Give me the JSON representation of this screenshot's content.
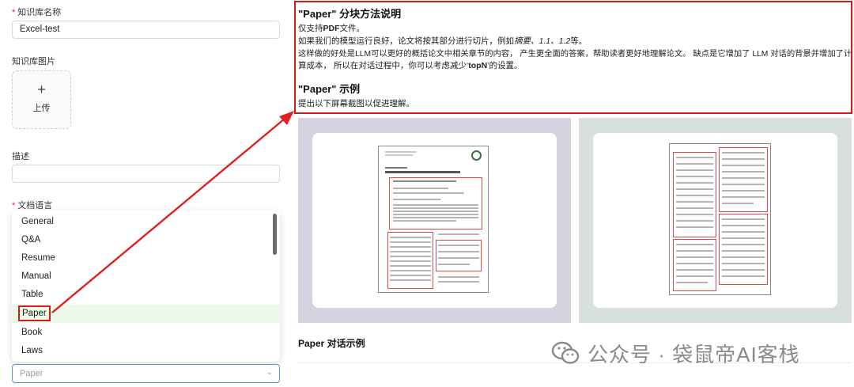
{
  "form": {
    "kb_name_label": "知识库名称",
    "kb_name_value": "Excel-test",
    "kb_image_label": "知识库图片",
    "upload_plus": "+",
    "upload_label": "上传",
    "description_label": "描述",
    "doc_language_label": "文档语言",
    "required_mark": "*",
    "chunk_method_options": [
      "General",
      "Q&A",
      "Resume",
      "Manual",
      "Table",
      "Paper",
      "Book",
      "Laws"
    ],
    "selected_option": "Paper",
    "select_placeholder": "Paper",
    "chevron": "⌄"
  },
  "doc": {
    "heading1": "\"Paper\" 分块方法说明",
    "line1_pre": "仅支持",
    "line1_bold": "PDF",
    "line1_post": "文件。",
    "line2_pre": "如果我们的模型运行良好，论文将按其部分进行切片，例如",
    "line2_italic": "摘要、1.1、1.2",
    "line2_post": "等。",
    "line3": "这样做的好处是LLM可以更好的概括论文中相关章节的内容， 产生更全面的答案，帮助读者更好地理解论文。 缺点是它增加了 LLM 对话的背景并增加了计",
    "line4_pre": "算成本， 所以在对话过程中，你可以考虑减少‘",
    "line4_bold": "topN",
    "line4_post": "’的设置。",
    "heading2": "\"Paper\" 示例",
    "line5": "提出以下屏幕截图以促进理解。",
    "section2_title": "Paper 对话示例"
  },
  "watermark": {
    "text": "公众号 · 袋鼠帝AI客栈",
    "icon": "wechat-icon"
  },
  "colors": {
    "highlight_red": "#d51a1a",
    "selected_bg": "#ecfbe9",
    "focus_blue": "#5b8dee"
  }
}
